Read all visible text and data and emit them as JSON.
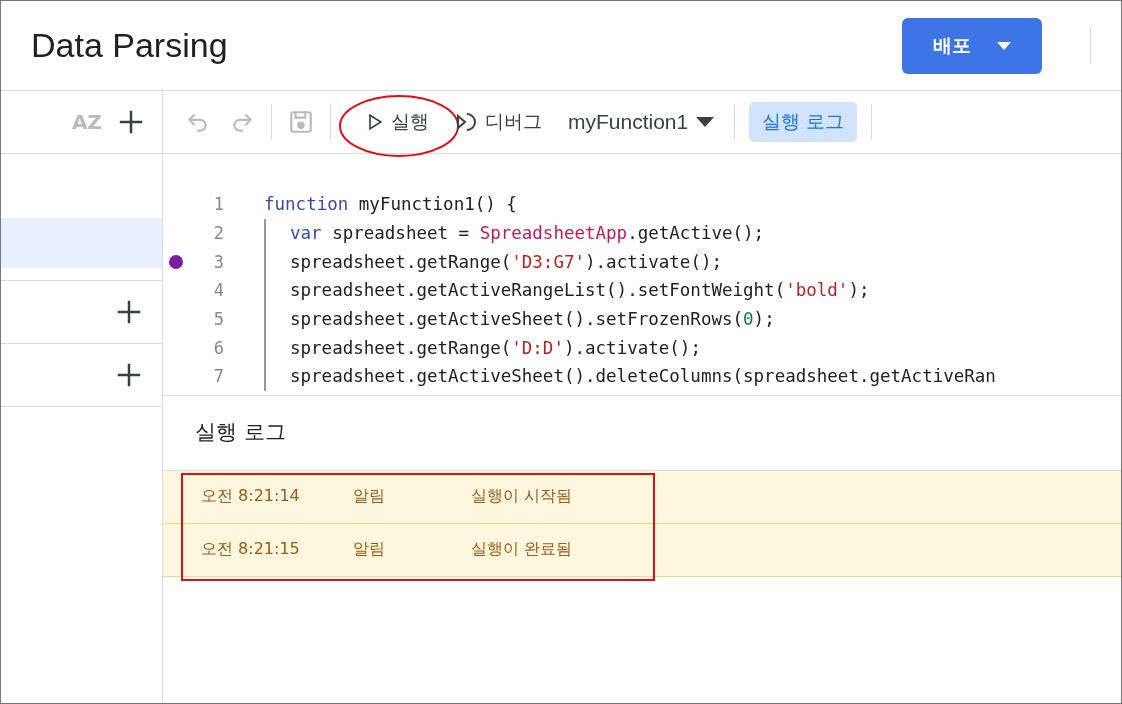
{
  "header": {
    "title": "Data Parsing",
    "deploy_button": "배포"
  },
  "sidebar": {
    "sort_label": "AZ",
    "file_rows": [
      {
        "selected": true
      }
    ]
  },
  "toolbar": {
    "run": "실행",
    "debug": "디버그",
    "function_select": "myFunction1",
    "log_toggle": {
      "label": "실행 로그",
      "selected": true
    }
  },
  "editor": {
    "lines": [
      {
        "number": "1",
        "breakpoint": false,
        "indent": false,
        "tokens": [
          {
            "kind": "keyword",
            "text": "function"
          },
          {
            "kind": "plain",
            "text": " myFunction1() {"
          }
        ]
      },
      {
        "number": "2",
        "breakpoint": false,
        "indent": true,
        "tokens": [
          {
            "kind": "keyword",
            "text": "var"
          },
          {
            "kind": "plain",
            "text": " spreadsheet = "
          },
          {
            "kind": "class",
            "text": "SpreadsheetApp"
          },
          {
            "kind": "plain",
            "text": ".getActive();"
          }
        ]
      },
      {
        "number": "3",
        "breakpoint": true,
        "indent": true,
        "tokens": [
          {
            "kind": "plain",
            "text": "spreadsheet.getRange("
          },
          {
            "kind": "string",
            "text": "'D3:G7'"
          },
          {
            "kind": "plain",
            "text": ").activate();"
          }
        ]
      },
      {
        "number": "4",
        "breakpoint": false,
        "indent": true,
        "tokens": [
          {
            "kind": "plain",
            "text": "spreadsheet.getActiveRangeList().setFontWeight("
          },
          {
            "kind": "string",
            "text": "'bold'"
          },
          {
            "kind": "plain",
            "text": ");"
          }
        ]
      },
      {
        "number": "5",
        "breakpoint": false,
        "indent": true,
        "tokens": [
          {
            "kind": "plain",
            "text": "spreadsheet.getActiveSheet().setFrozenRows("
          },
          {
            "kind": "number",
            "text": "0"
          },
          {
            "kind": "plain",
            "text": ");"
          }
        ]
      },
      {
        "number": "6",
        "breakpoint": false,
        "indent": true,
        "tokens": [
          {
            "kind": "plain",
            "text": "spreadsheet.getRange("
          },
          {
            "kind": "string",
            "text": "'D:D'"
          },
          {
            "kind": "plain",
            "text": ").activate();"
          }
        ]
      },
      {
        "number": "7",
        "breakpoint": false,
        "indent": true,
        "tokens": [
          {
            "kind": "plain",
            "text": "spreadsheet.getActiveSheet().deleteColumns(spreadsheet.getActiveRan"
          }
        ]
      }
    ]
  },
  "log": {
    "title": "실행 로그",
    "rows": [
      {
        "time": "오전 8:21:14",
        "level": "알림",
        "message": "실행이 시작됨"
      },
      {
        "time": "오전 8:21:15",
        "level": "알림",
        "message": "실행이 완료됨"
      }
    ]
  }
}
